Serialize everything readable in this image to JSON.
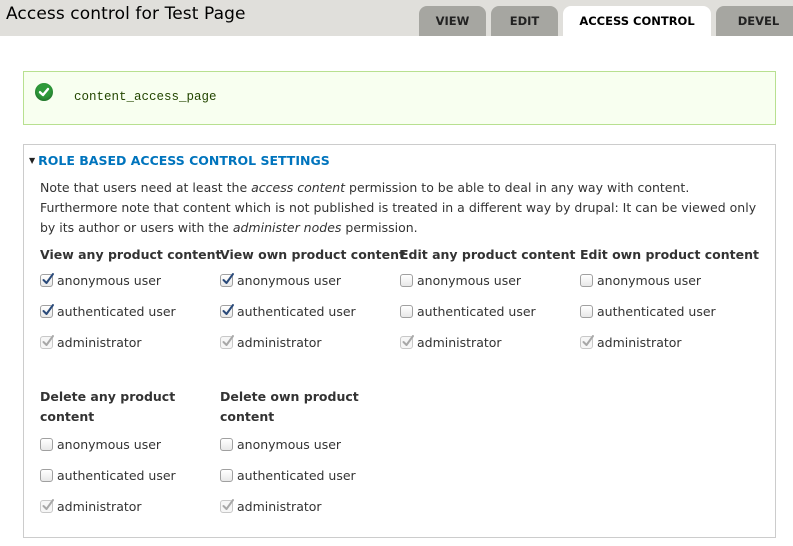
{
  "header": {
    "title": "Access control for Test Page",
    "tabs": [
      {
        "label": "VIEW",
        "active": false
      },
      {
        "label": "EDIT",
        "active": false
      },
      {
        "label": "ACCESS CONTROL",
        "active": true
      },
      {
        "label": "DEVEL",
        "active": false
      }
    ]
  },
  "message": {
    "icon": "check-circle-icon",
    "text": "content_access_page",
    "accent_color": "#2e9a3a"
  },
  "fieldset": {
    "legend": "ROLE BASED ACCESS CONTROL SETTINGS",
    "description": {
      "p1_before": "Note that users need at least the ",
      "p1_em": "access content",
      "p1_after": " permission to be able to deal in any way with content.",
      "p2_before": "Furthermore note that content which is not published is treated in a different way by drupal: It can be viewed only by its author or users with the ",
      "p2_em": "administer nodes",
      "p2_after": " permission."
    },
    "permissions": [
      {
        "title": "View any product content",
        "options": [
          {
            "label": "anonymous user",
            "state": "checked"
          },
          {
            "label": "authenticated user",
            "state": "checked"
          },
          {
            "label": "administrator",
            "state": "disabled-checked"
          }
        ]
      },
      {
        "title": "View own product content",
        "options": [
          {
            "label": "anonymous user",
            "state": "checked"
          },
          {
            "label": "authenticated user",
            "state": "checked"
          },
          {
            "label": "administrator",
            "state": "disabled-checked"
          }
        ]
      },
      {
        "title": "Edit any product content",
        "options": [
          {
            "label": "anonymous user",
            "state": "unchecked"
          },
          {
            "label": "authenticated user",
            "state": "unchecked"
          },
          {
            "label": "administrator",
            "state": "disabled-checked"
          }
        ]
      },
      {
        "title": "Edit own product content",
        "options": [
          {
            "label": "anonymous user",
            "state": "unchecked"
          },
          {
            "label": "authenticated user",
            "state": "unchecked"
          },
          {
            "label": "administrator",
            "state": "disabled-checked"
          }
        ]
      },
      {
        "title": "Delete any product content",
        "options": [
          {
            "label": "anonymous user",
            "state": "unchecked"
          },
          {
            "label": "authenticated user",
            "state": "unchecked"
          },
          {
            "label": "administrator",
            "state": "disabled-checked"
          }
        ]
      },
      {
        "title": "Delete own product content",
        "options": [
          {
            "label": "anonymous user",
            "state": "unchecked"
          },
          {
            "label": "authenticated user",
            "state": "unchecked"
          },
          {
            "label": "administrator",
            "state": "disabled-checked"
          }
        ]
      }
    ]
  }
}
